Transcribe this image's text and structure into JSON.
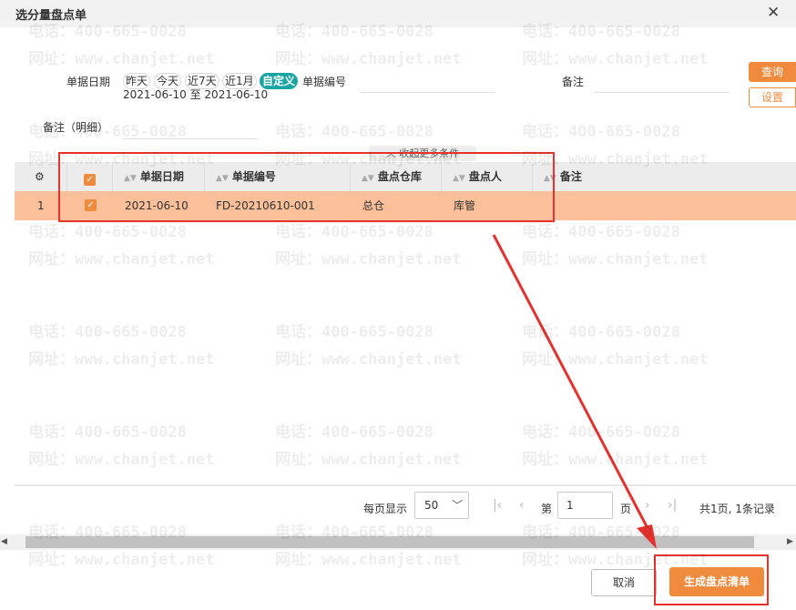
{
  "dialog": {
    "title": "选分量盘点单",
    "close_icon": "close-icon"
  },
  "watermark": {
    "phone": "电话：400-665-0028",
    "site": "网址：www.chanjet.net"
  },
  "filters": {
    "date_label": "单据日期",
    "quick_dates": [
      "昨天",
      "今天",
      "近7天",
      "近1月",
      "自定义"
    ],
    "active_quick_date": "自定义",
    "date_from": "2021-06-10",
    "date_to": "2021-06-10",
    "date_sep": "至",
    "doc_no_label": "单据编号",
    "doc_no_value": "",
    "remark_label": "备注",
    "remark_value": "",
    "detail_remark_label": "备注（明细）",
    "detail_remark_value": "",
    "collapse_label": "收起更多条件",
    "query_button": "查询",
    "settings_button": "设置"
  },
  "table": {
    "columns": [
      "单据日期",
      "单据编号",
      "盘点仓库",
      "盘点人",
      "备注"
    ],
    "rows": [
      {
        "index": "1",
        "checked": true,
        "date": "2021-06-10",
        "doc_no": "FD-20210610-001",
        "warehouse": "总仓",
        "operator": "库管",
        "remark": ""
      }
    ]
  },
  "pager": {
    "per_page_label": "每页显示",
    "per_page_value": "50",
    "page_prefix": "第",
    "page_value": "1",
    "page_suffix": "页",
    "summary": "共1页, 1条记录"
  },
  "footer": {
    "cancel_button": "取消",
    "generate_button": "生成盘点清单"
  },
  "colors": {
    "accent": "#f08b3e",
    "selected_row": "#fbbf99",
    "annotation_red": "#e5322e",
    "teal": "#1aa5a5"
  }
}
